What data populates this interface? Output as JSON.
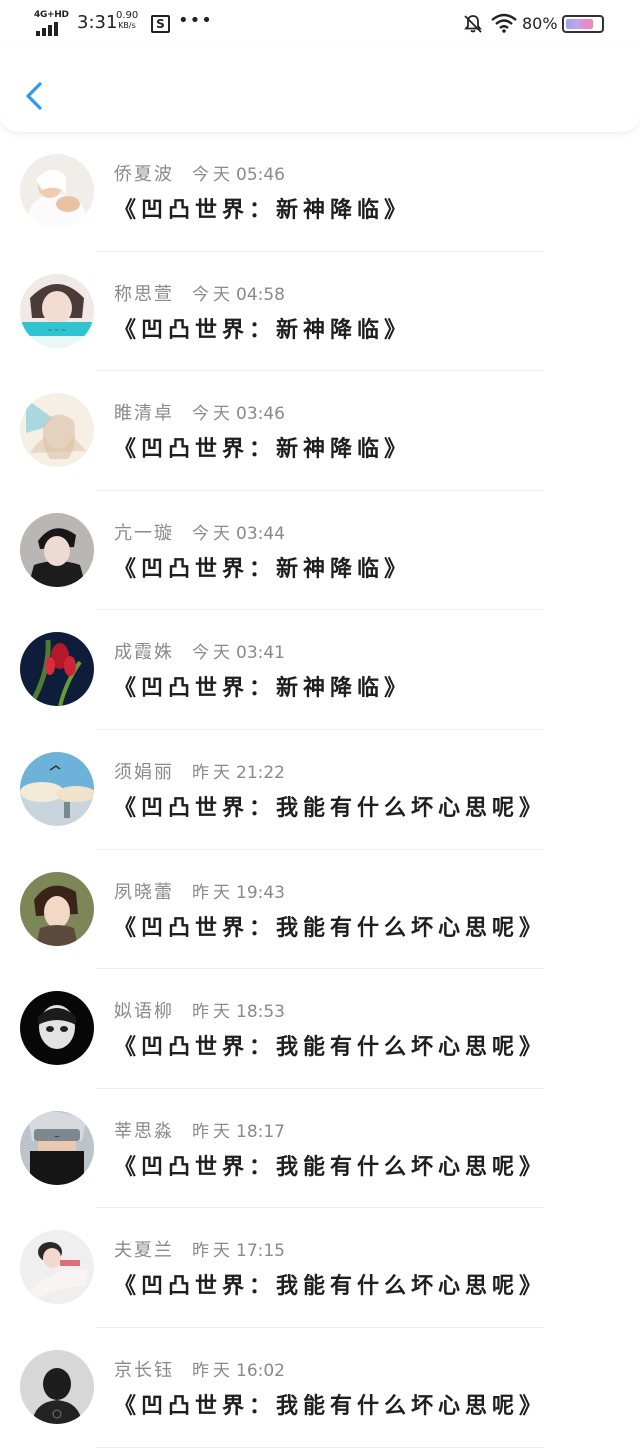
{
  "status_bar": {
    "network": "4G+HD",
    "time": "3:31",
    "speed_value": "0.90",
    "speed_unit": "KB/s",
    "app_icon": "S",
    "more": "•••",
    "battery_percent": "80%",
    "battery_level": 0.8,
    "icons": [
      "signal-bars-icon",
      "app-s-icon",
      "bell-muted-icon",
      "wifi-icon",
      "battery-icon"
    ]
  },
  "header": {
    "back_icon": "chevron-left-icon",
    "accent_color": "#2b9af3"
  },
  "messages": [
    {
      "name": "侨夏波",
      "day": "今天",
      "time": "05:46",
      "text": "《凹凸世界：新神降临》"
    },
    {
      "name": "称思萱",
      "day": "今天",
      "time": "04:58",
      "text": "《凹凸世界：新神降临》"
    },
    {
      "name": "睢清卓",
      "day": "今天",
      "time": "03:46",
      "text": "《凹凸世界：新神降临》"
    },
    {
      "name": "亢一璇",
      "day": "今天",
      "time": "03:44",
      "text": "《凹凸世界：新神降临》"
    },
    {
      "name": "成霞姝",
      "day": "今天",
      "time": "03:41",
      "text": "《凹凸世界：新神降临》"
    },
    {
      "name": "须娟丽",
      "day": "昨天",
      "time": "21:22",
      "text": "《凹凸世界：我能有什么坏心思呢》"
    },
    {
      "name": "夙晓蕾",
      "day": "昨天",
      "time": "19:43",
      "text": "《凹凸世界：我能有什么坏心思呢》"
    },
    {
      "name": "姒语柳",
      "day": "昨天",
      "time": "18:53",
      "text": "《凹凸世界：我能有什么坏心思呢》"
    },
    {
      "name": "莘思淼",
      "day": "昨天",
      "time": "18:17",
      "text": "《凹凸世界：我能有什么坏心思呢》"
    },
    {
      "name": "夫夏兰",
      "day": "昨天",
      "time": "17:15",
      "text": "《凹凸世界：我能有什么坏心思呢》"
    },
    {
      "name": "京长钰",
      "day": "昨天",
      "time": "16:02",
      "text": "《凹凸世界：我能有什么坏心思呢》"
    }
  ]
}
